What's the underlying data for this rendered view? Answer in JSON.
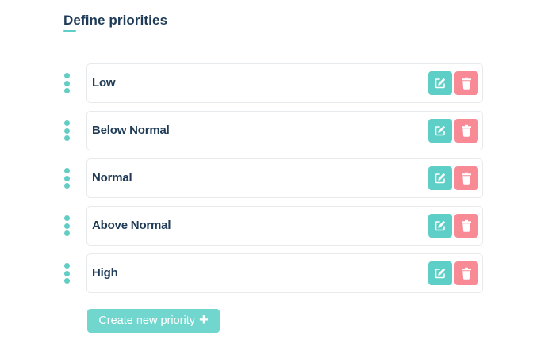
{
  "page": {
    "title": "Define priorities"
  },
  "priorities": [
    {
      "label": "Low"
    },
    {
      "label": "Below Normal"
    },
    {
      "label": "Normal"
    },
    {
      "label": "Above Normal"
    },
    {
      "label": "High"
    }
  ],
  "actions": {
    "create_label": "Create new priority",
    "create_icon": "+",
    "edit_icon": "edit-icon",
    "delete_icon": "trash-icon"
  },
  "colors": {
    "accent": "#5ecfc7",
    "danger": "#f78a94",
    "heading": "#1f3b57"
  }
}
